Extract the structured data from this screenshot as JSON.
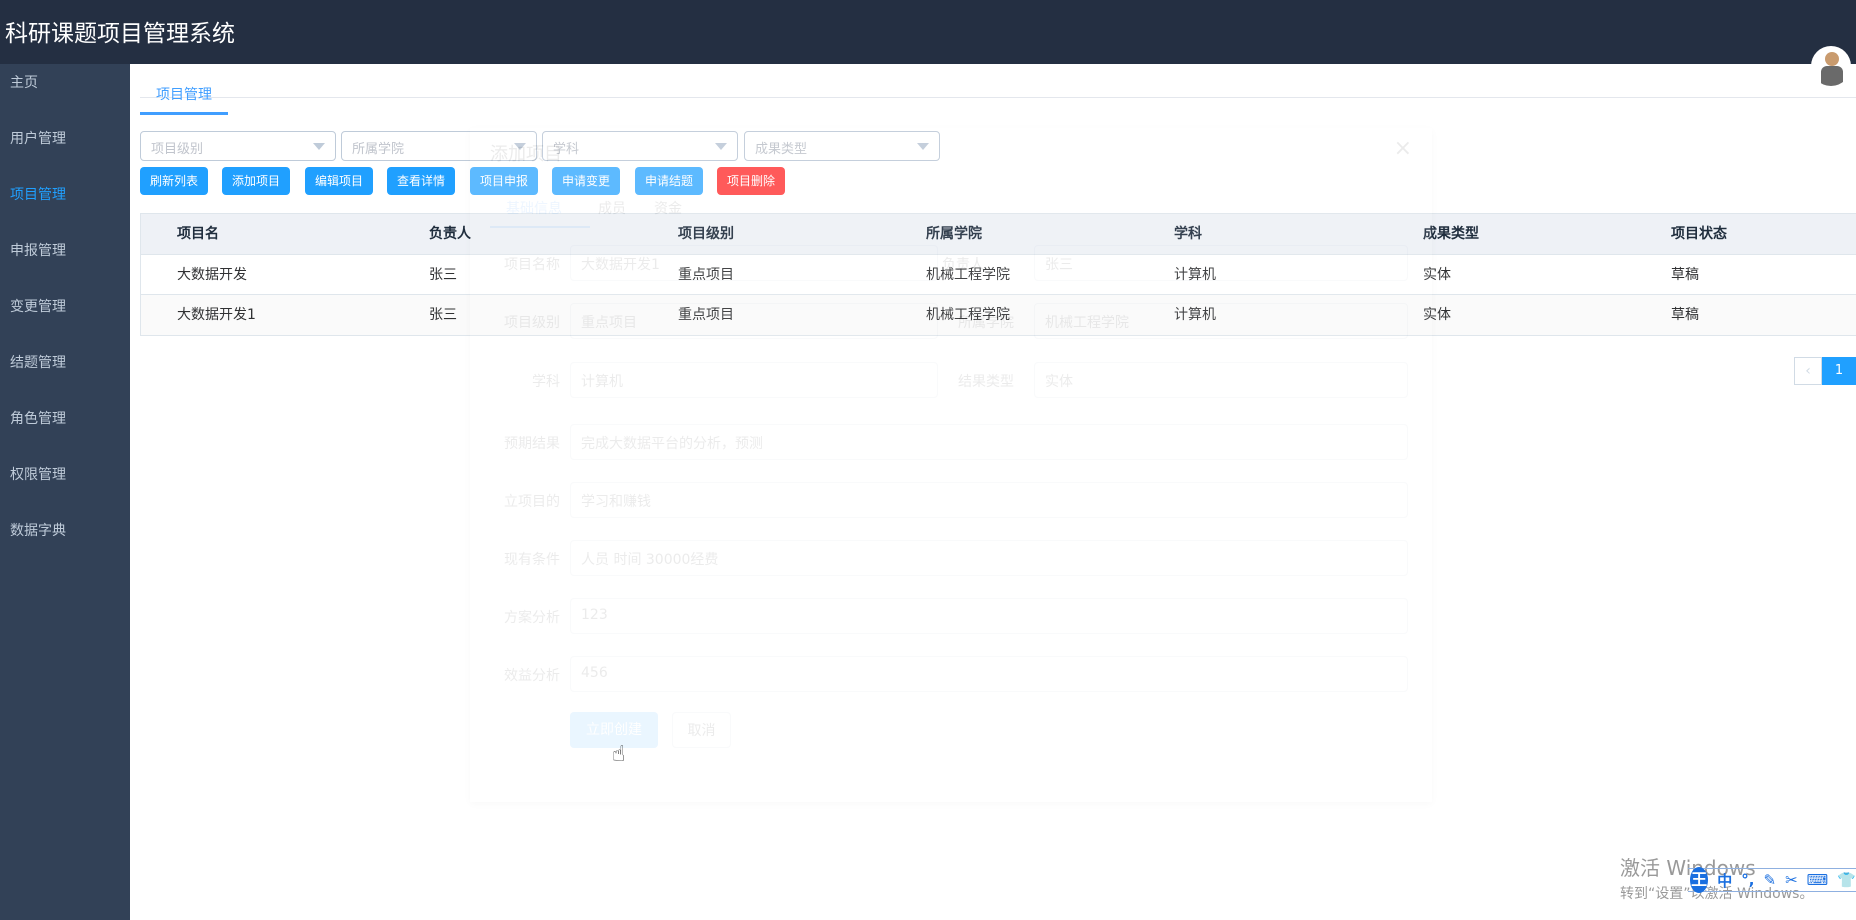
{
  "header": {
    "title": "科研课题项目管理系统"
  },
  "sidebar": {
    "items": [
      {
        "label": "主页"
      },
      {
        "label": "用户管理"
      },
      {
        "label": "项目管理"
      },
      {
        "label": "申报管理"
      },
      {
        "label": "变更管理"
      },
      {
        "label": "结题管理"
      },
      {
        "label": "角色管理"
      },
      {
        "label": "权限管理"
      },
      {
        "label": "数据字典"
      }
    ],
    "active": "项目管理"
  },
  "tab": {
    "label": "项目管理"
  },
  "filters": [
    {
      "placeholder": "项目级别"
    },
    {
      "placeholder": "所属学院"
    },
    {
      "placeholder": "学科"
    },
    {
      "placeholder": "成果类型"
    }
  ],
  "toolbar": [
    "刷新列表",
    "添加项目",
    "编辑项目",
    "查看详情",
    "项目申报",
    "申请变更",
    "申请结题",
    "项目删除"
  ],
  "table": {
    "columns": [
      "项目名",
      "负责人",
      "项目级别",
      "所属学院",
      "学科",
      "成果类型",
      "项目状态"
    ],
    "rows": [
      [
        "大数据开发",
        "张三",
        "重点项目",
        "机械工程学院",
        "计算机",
        "实体",
        "草稿"
      ],
      [
        "大数据开发1",
        "张三",
        "重点项目",
        "机械工程学院",
        "计算机",
        "实体",
        "草稿"
      ]
    ]
  },
  "pagination": {
    "prev": "‹",
    "current": "1"
  },
  "dialog": {
    "title": "添加项目",
    "close": "×",
    "tabs": [
      "基础信息",
      "成员",
      "资金"
    ],
    "fields": {
      "name_label": "项目名称",
      "name": "大数据开发1",
      "leader_label": "负责人",
      "leader": "张三",
      "level_label": "项目级别",
      "level": "重点项目",
      "college_label": "所属学院",
      "college": "机械工程学院",
      "subject_label": "学科",
      "subject": "计算机",
      "result_type_label": "结果类型",
      "result_type": "实体",
      "expected_label": "预期结果",
      "expected": "完成大数据平台的分析，预测",
      "purpose_label": "立项目的",
      "purpose": "学习和赚钱",
      "conditions_label": "现有条件",
      "conditions": "人员 时间 30000经费",
      "plan_label": "方案分析",
      "plan": "123",
      "benefit_label": "效益分析",
      "benefit": "456"
    },
    "create": "立即创建",
    "cancel": "取消"
  },
  "watermark": {
    "line1": "激活 Windows",
    "line2": "转到“设置”以激活 Windows。"
  },
  "ime": {
    "logo": "王",
    "mode": "中"
  }
}
